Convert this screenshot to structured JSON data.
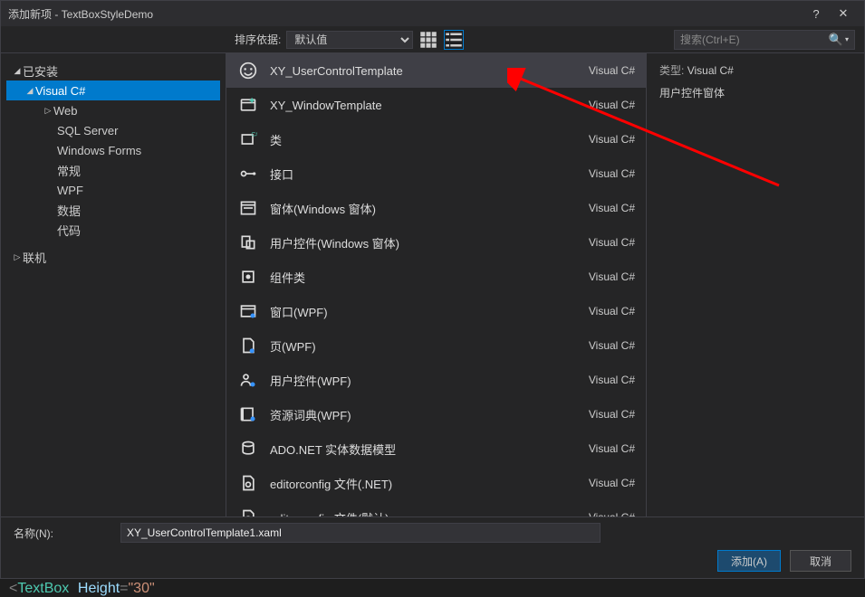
{
  "title": "添加新项 - TextBoxStyleDemo",
  "toolbar": {
    "sort_label": "排序依据:",
    "sort_value": "默认值",
    "search_placeholder": "搜索(Ctrl+E)"
  },
  "tree": {
    "installed": "已安装",
    "visual_csharp": "Visual C#",
    "web": "Web",
    "sql": "SQL Server",
    "winforms": "Windows Forms",
    "general": "常规",
    "wpf": "WPF",
    "data": "数据",
    "code": "代码",
    "online": "联机"
  },
  "items": [
    {
      "name": "XY_UserControlTemplate",
      "lang": "Visual C#",
      "icon": "smile"
    },
    {
      "name": "XY_WindowTemplate",
      "lang": "Visual C#",
      "icon": "window-plus"
    },
    {
      "name": "类",
      "lang": "Visual C#",
      "icon": "class"
    },
    {
      "name": "接口",
      "lang": "Visual C#",
      "icon": "interface"
    },
    {
      "name": "窗体(Windows 窗体)",
      "lang": "Visual C#",
      "icon": "form"
    },
    {
      "name": "用户控件(Windows 窗体)",
      "lang": "Visual C#",
      "icon": "user-control"
    },
    {
      "name": "组件类",
      "lang": "Visual C#",
      "icon": "component"
    },
    {
      "name": "窗口(WPF)",
      "lang": "Visual C#",
      "icon": "wpf-window"
    },
    {
      "name": "页(WPF)",
      "lang": "Visual C#",
      "icon": "page"
    },
    {
      "name": "用户控件(WPF)",
      "lang": "Visual C#",
      "icon": "wpf-uc"
    },
    {
      "name": "资源词典(WPF)",
      "lang": "Visual C#",
      "icon": "res-dict"
    },
    {
      "name": "ADO.NET 实体数据模型",
      "lang": "Visual C#",
      "icon": "ado"
    },
    {
      "name": "editorconfig 文件(.NET)",
      "lang": "Visual C#",
      "icon": "editorconfig"
    },
    {
      "name": "editorconfig 文件(默认)",
      "lang": "Visual C#",
      "icon": "editorconfig"
    }
  ],
  "details": {
    "type_label": "类型:",
    "type_value": "Visual C#",
    "desc": "用户控件窗体"
  },
  "footer": {
    "name_label": "名称(N):",
    "name_value": "XY_UserControlTemplate1.xaml",
    "add": "添加(A)",
    "cancel": "取消"
  },
  "code": {
    "punc1": "<",
    "elem": "TextBox",
    "attr": "Height",
    "punc2": "=",
    "val": "\"30\""
  }
}
